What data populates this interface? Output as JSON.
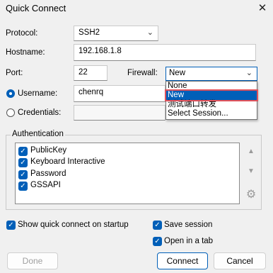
{
  "window": {
    "title": "Quick Connect",
    "close_glyph": "✕"
  },
  "form": {
    "protocol_label": "Protocol:",
    "protocol_value": "SSH2",
    "hostname_label": "Hostname:",
    "hostname_value": "192.168.1.8",
    "port_label": "Port:",
    "port_value": "22",
    "firewall_label": "Firewall:",
    "firewall_value": "New",
    "username_label": "Username:",
    "username_value": "chenrq",
    "credentials_label": "Credentials:"
  },
  "firewall_dropdown": {
    "options": [
      "None",
      "New",
      "测试端口转发",
      "Select Session..."
    ],
    "selected": "New"
  },
  "authentication": {
    "group_label": "Authentication",
    "methods": [
      {
        "label": "PublicKey",
        "checked": true
      },
      {
        "label": "Keyboard Interactive",
        "checked": true
      },
      {
        "label": "Password",
        "checked": true
      },
      {
        "label": "GSSAPI",
        "checked": true
      }
    ]
  },
  "options": {
    "show_on_startup": "Show quick connect on startup",
    "save_session": "Save session",
    "open_in_tab": "Open in a tab"
  },
  "buttons": {
    "done": "Done",
    "connect": "Connect",
    "cancel": "Cancel"
  },
  "colors": {
    "accent": "#005fb8",
    "highlight_outline": "#e0525b"
  }
}
